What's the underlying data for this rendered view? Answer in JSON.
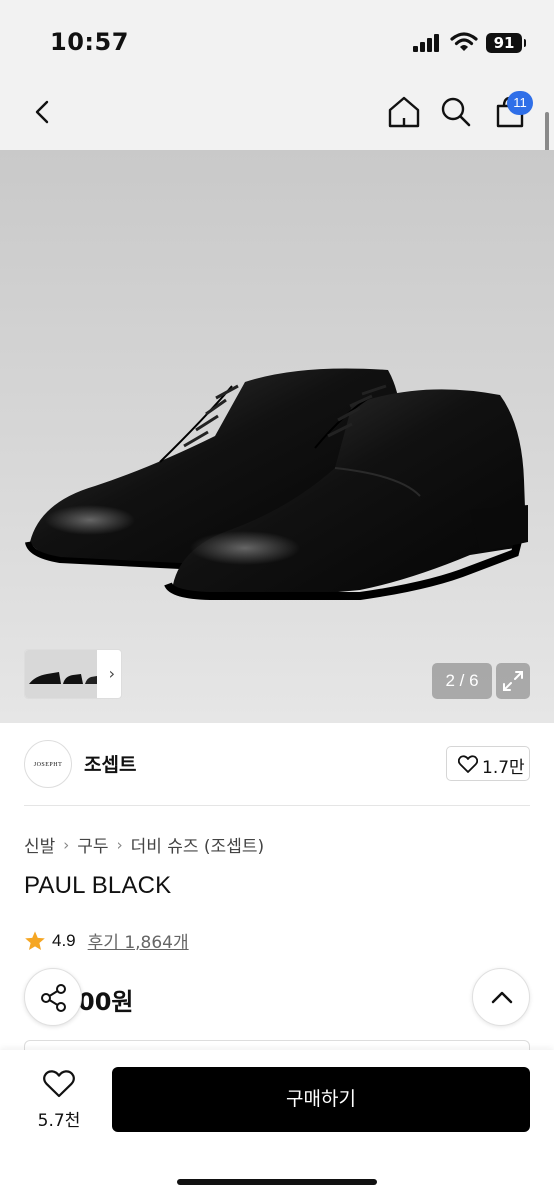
{
  "status": {
    "time": "10:57",
    "battery": "91"
  },
  "nav": {
    "cart_badge": "11"
  },
  "gallery": {
    "counter": "2 / 6"
  },
  "brand": {
    "logo_text": "JOSEPHT",
    "name": "조셉트",
    "like_count": "1.7만"
  },
  "breadcrumb": {
    "level1": "신발",
    "level2": "구두",
    "level3": "더비 슈즈 (조셉트)"
  },
  "product": {
    "title": "PAUL BLACK",
    "rating": "4.9",
    "reviews": "후기 1,864개",
    "price_visible": "00원"
  },
  "bottom": {
    "wish_count": "5.7천",
    "buy_label": "구매하기"
  },
  "colors": {
    "accent_badge": "#2f6fe8",
    "star": "#f5a623",
    "buy_button": "#000000"
  },
  "icons": [
    "back-icon",
    "home-icon",
    "search-icon",
    "shopping-bag-icon",
    "expand-icon",
    "heart-icon",
    "star-icon",
    "share-icon",
    "chevron-up-icon"
  ]
}
